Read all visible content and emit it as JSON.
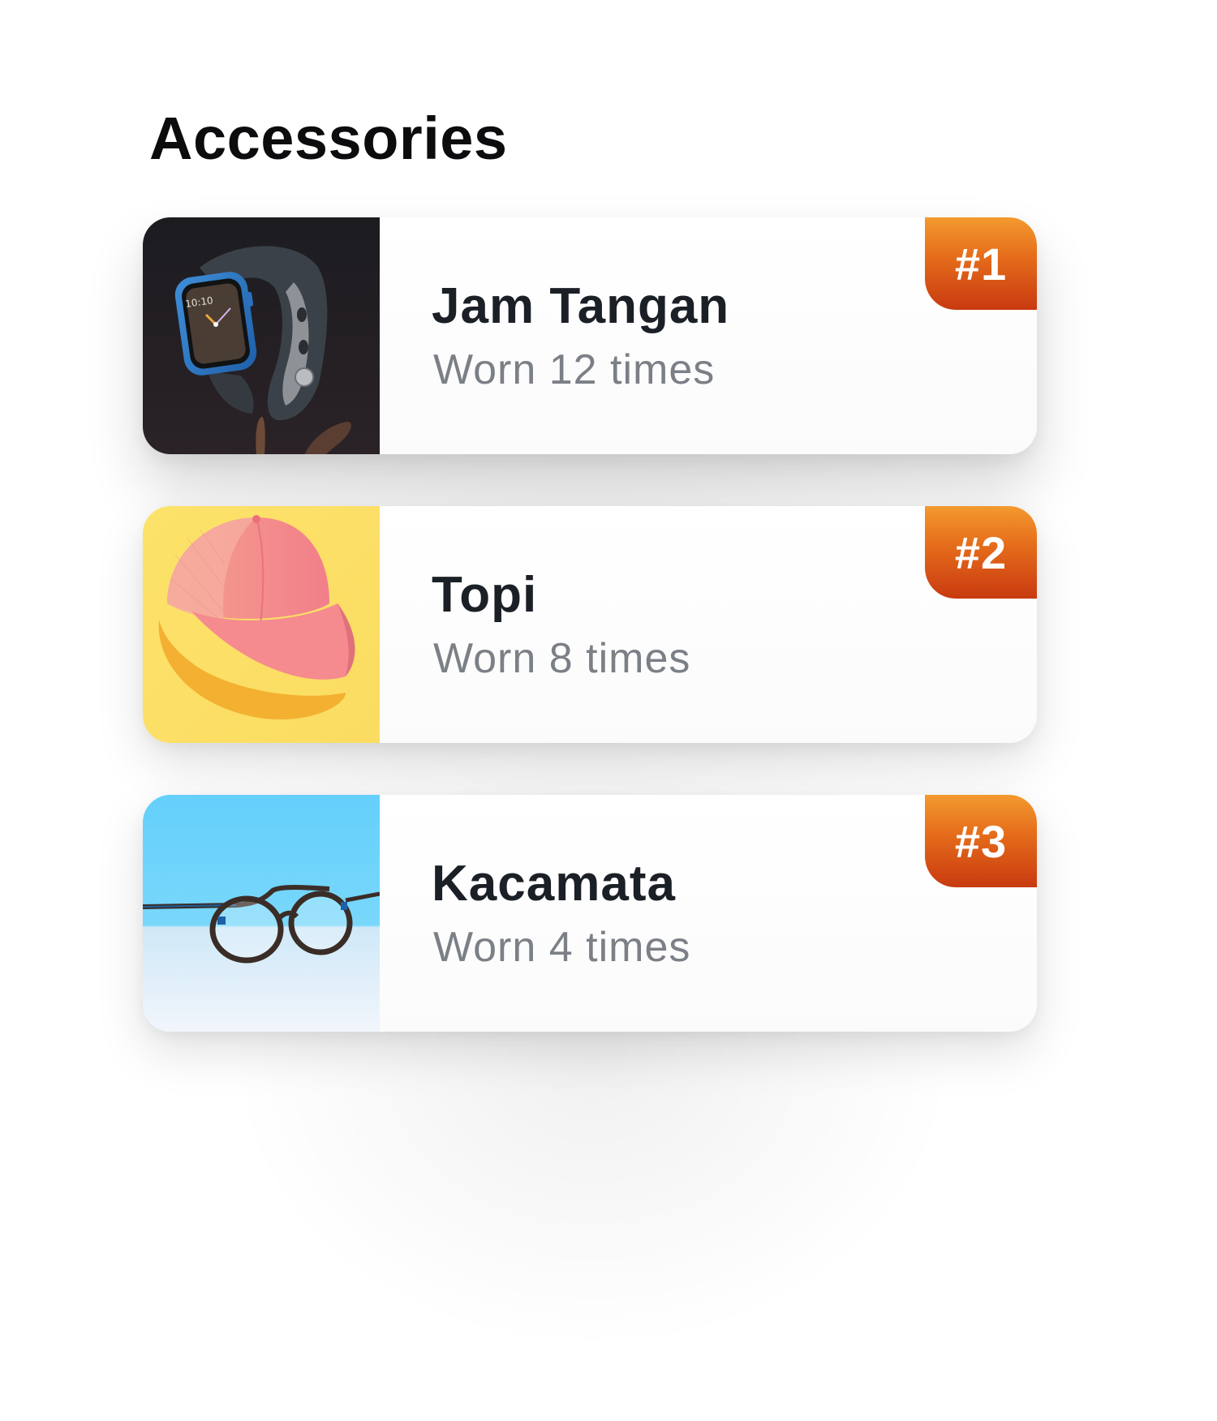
{
  "section": {
    "title": "Accessories"
  },
  "colors": {
    "badge_top": "#f39a2e",
    "badge_bottom": "#c83a10",
    "name_text": "#1b1f26",
    "sub_text": "#7b7f86"
  },
  "items": [
    {
      "name": "Jam Tangan",
      "worn_label": "Worn",
      "worn_count": "12",
      "worn_unit": "times",
      "rank": "#1",
      "image": "smartwatch-photo"
    },
    {
      "name": "Topi",
      "worn_label": "Worn",
      "worn_count": "8",
      "worn_unit": "times",
      "rank": "#2",
      "image": "pink-cap-photo"
    },
    {
      "name": "Kacamata",
      "worn_label": "Worn",
      "worn_count": "4",
      "worn_unit": "times",
      "rank": "#3",
      "image": "eyeglasses-photo"
    }
  ]
}
